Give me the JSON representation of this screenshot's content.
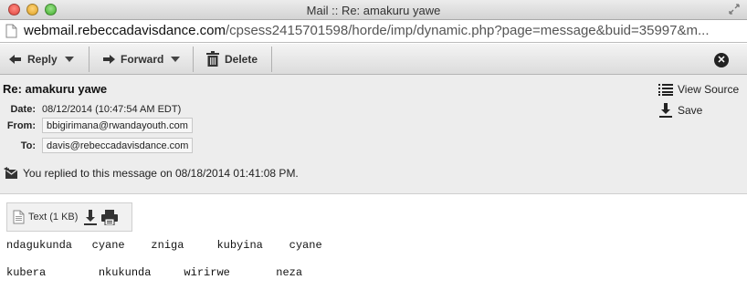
{
  "window": {
    "title": "Mail :: Re: amakuru yawe"
  },
  "urlbar": {
    "host": "webmail.rebeccadavisdance.com",
    "path": "/cpsess2415701598/horde/imp/dynamic.php?page=message&buid=35997&m..."
  },
  "toolbar": {
    "reply_label": "Reply",
    "forward_label": "Forward",
    "delete_label": "Delete"
  },
  "message": {
    "subject": "Re: amakuru yawe",
    "date_label": "Date:",
    "date_value": "08/12/2014 (10:47:54 AM EDT)",
    "from_label": "From:",
    "from_value": "bbigirimana@rwandayouth.com",
    "to_label": "To:",
    "to_value": "davis@rebeccadavisdance.com",
    "replied_notice": "You replied to this message on 08/18/2014 01:41:08 PM.",
    "view_source_label": "View Source",
    "save_label": "Save"
  },
  "attachment": {
    "label": "Text (1 KB)"
  },
  "body": {
    "line1": "ndagukunda   cyane    zniga     kubyina    cyane",
    "line2": "kubera        nkukunda     wirirwe       neza"
  }
}
